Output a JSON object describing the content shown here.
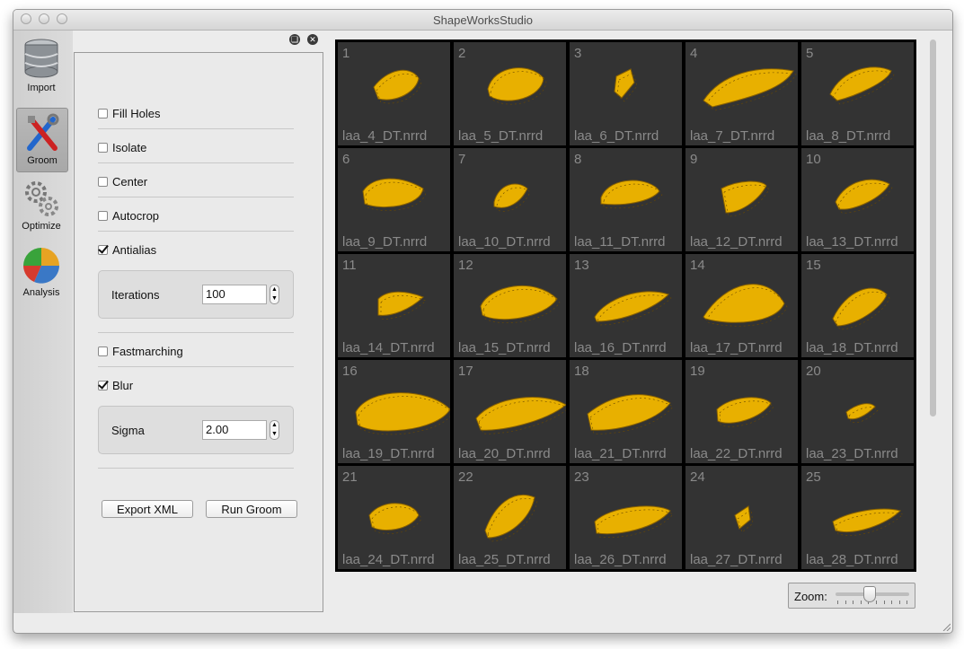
{
  "window": {
    "title": "ShapeWorksStudio"
  },
  "toolbar": {
    "items": [
      {
        "label": "Import",
        "icon": "database-icon"
      },
      {
        "label": "Groom",
        "icon": "tools-icon",
        "active": true
      },
      {
        "label": "Optimize",
        "icon": "gears-icon"
      },
      {
        "label": "Analysis",
        "icon": "pie-chart-icon"
      }
    ]
  },
  "groom": {
    "options": [
      {
        "label": "Fill Holes",
        "checked": false
      },
      {
        "label": "Isolate",
        "checked": false
      },
      {
        "label": "Center",
        "checked": false
      },
      {
        "label": "Autocrop",
        "checked": false
      },
      {
        "label": "Antialias",
        "checked": true
      },
      {
        "label": "Fastmarching",
        "checked": false
      },
      {
        "label": "Blur",
        "checked": true
      }
    ],
    "iterations": {
      "label": "Iterations",
      "value": "100"
    },
    "sigma": {
      "label": "Sigma",
      "value": "2.00"
    },
    "export_label": "Export XML",
    "run_label": "Run Groom"
  },
  "viewer": {
    "shape_color": "#e8b000",
    "tiles": [
      {
        "n": "1",
        "file": "laa_4_DT.nrrd"
      },
      {
        "n": "2",
        "file": "laa_5_DT.nrrd"
      },
      {
        "n": "3",
        "file": "laa_6_DT.nrrd"
      },
      {
        "n": "4",
        "file": "laa_7_DT.nrrd"
      },
      {
        "n": "5",
        "file": "laa_8_DT.nrrd"
      },
      {
        "n": "6",
        "file": "laa_9_DT.nrrd"
      },
      {
        "n": "7",
        "file": "laa_10_DT.nrrd"
      },
      {
        "n": "8",
        "file": "laa_11_DT.nrrd"
      },
      {
        "n": "9",
        "file": "laa_12_DT.nrrd"
      },
      {
        "n": "10",
        "file": "laa_13_DT.nrrd"
      },
      {
        "n": "11",
        "file": "laa_14_DT.nrrd"
      },
      {
        "n": "12",
        "file": "laa_15_DT.nrrd"
      },
      {
        "n": "13",
        "file": "laa_16_DT.nrrd"
      },
      {
        "n": "14",
        "file": "laa_17_DT.nrrd"
      },
      {
        "n": "15",
        "file": "laa_18_DT.nrrd"
      },
      {
        "n": "16",
        "file": "laa_19_DT.nrrd"
      },
      {
        "n": "17",
        "file": "laa_20_DT.nrrd"
      },
      {
        "n": "18",
        "file": "laa_21_DT.nrrd"
      },
      {
        "n": "19",
        "file": "laa_22_DT.nrrd"
      },
      {
        "n": "20",
        "file": "laa_23_DT.nrrd"
      },
      {
        "n": "21",
        "file": "laa_24_DT.nrrd"
      },
      {
        "n": "22",
        "file": "laa_25_DT.nrrd"
      },
      {
        "n": "23",
        "file": "laa_26_DT.nrrd"
      },
      {
        "n": "24",
        "file": "laa_27_DT.nrrd"
      },
      {
        "n": "25",
        "file": "laa_28_DT.nrrd"
      }
    ]
  },
  "zoom": {
    "label": "Zoom:",
    "level": 0.45
  }
}
